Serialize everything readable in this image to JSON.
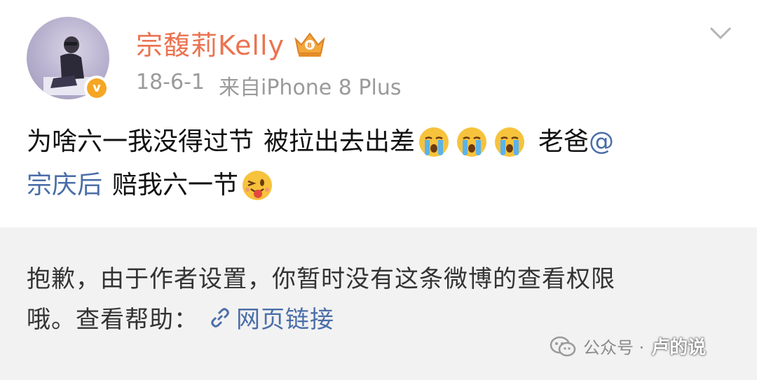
{
  "post": {
    "author_name": "宗馥莉Kelly",
    "timestamp": "18-6-1",
    "source": "来自iPhone 8 Plus",
    "content": {
      "line1_text": "为啥六一我没得过节",
      "line1_text2": "被拉出去出差",
      "line1_text3": "老爸",
      "mention_at": "@",
      "mention_name": "宗庆后",
      "line2_text": "赔我六一节"
    },
    "emojis": [
      "crying-emoji",
      "crying-emoji",
      "crying-emoji",
      "wink-tongue-emoji"
    ],
    "colors": {
      "name": "#eb7350",
      "mention": "#4a6ea8",
      "meta": "#9a9a9a",
      "badge": "#f5a623"
    }
  },
  "notice": {
    "line1": "抱歉，由于作者设置，你暂时没有这条微博的查看权限",
    "line2_prefix": "哦。查看帮助：",
    "link_label": "网页链接"
  },
  "watermark": {
    "label": "公众号 ·",
    "account": "卢的说"
  }
}
